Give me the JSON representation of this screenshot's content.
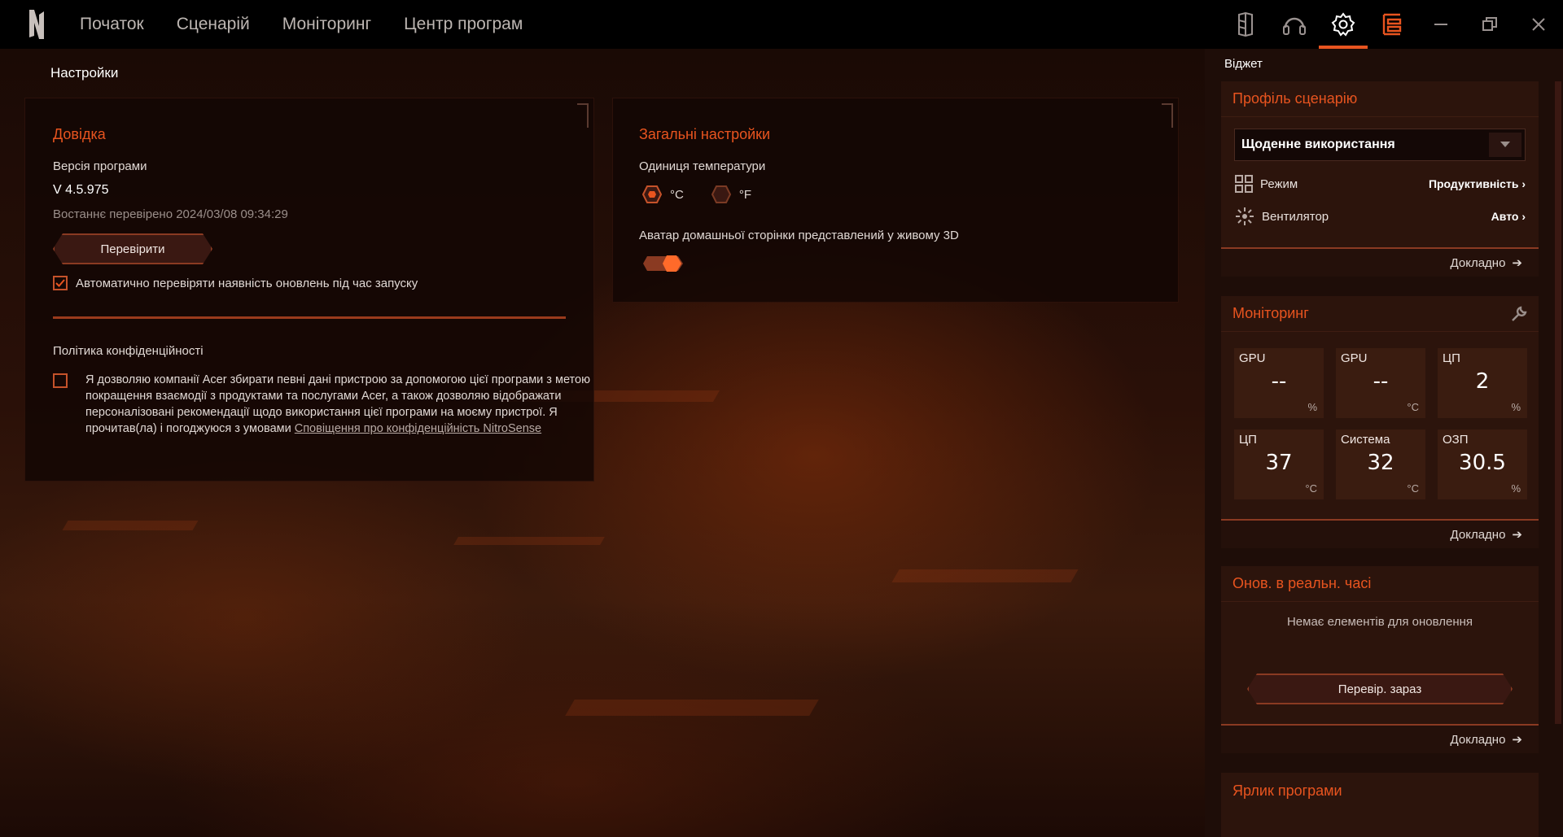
{
  "nav": {
    "items": [
      "Початок",
      "Сценарій",
      "Моніторинг",
      "Центр програм"
    ]
  },
  "top_icons": [
    "keyboard-icon",
    "headset-icon",
    "settings-icon",
    "widget-icon",
    "minimize-icon",
    "restore-icon",
    "close-icon"
  ],
  "page": {
    "title": "Настройки"
  },
  "help": {
    "title": "Довідка",
    "version_label": "Версія програми",
    "version_value": "V 4.5.975",
    "last_checked": "Востаннє перевірено 2024/03/08 09:34:29",
    "check_button": "Перевірити",
    "auto_check_label": "Автоматично перевіряти наявність оновлень під час запуску",
    "auto_check": true,
    "privacy_title": "Політика конфіденційності",
    "privacy_text": "Я дозволяю компанії Acer збирати певні дані пристрою за допомогою цієї програми з метою покращення взаємодії з продуктами та послугами Acer, а також дозволяю відображати персоналізовані рекомендації щодо використання цієї програми на моєму пристрої. Я прочитав(ла) і погоджуюся з умовами",
    "privacy_link": "Сповіщення про конфіденційність NitroSense",
    "privacy_checked": false
  },
  "general": {
    "title": "Загальні настройки",
    "temp_unit_label": "Одиниця температури",
    "unit_c": "°C",
    "unit_f": "°F",
    "selected_unit": "°C",
    "avatar_label": "Аватар домашньої сторінки представлений у живому 3D",
    "avatar_enabled": true
  },
  "sidebar": {
    "title": "Віджет",
    "profile": {
      "title": "Профіль сценарію",
      "selected": "Щоденне використання",
      "mode_label": "Режим",
      "mode_value": "Продуктивність",
      "fan_label": "Вентилятор",
      "fan_value": "Авто",
      "more": "Докладно"
    },
    "monitoring": {
      "title": "Моніторинг",
      "tiles": [
        {
          "name": "GPU",
          "value": "--",
          "unit": "%"
        },
        {
          "name": "GPU",
          "value": "--",
          "unit": "°C"
        },
        {
          "name": "ЦП",
          "value": "2",
          "unit": "%"
        },
        {
          "name": "ЦП",
          "value": "37",
          "unit": "°C"
        },
        {
          "name": "Система",
          "value": "32",
          "unit": "°C"
        },
        {
          "name": "ОЗП",
          "value": "30.5",
          "unit": "%"
        }
      ],
      "more": "Докладно"
    },
    "updates": {
      "title": "Онов. в реальн. часі",
      "empty": "Немає елементів для оновлення",
      "check_button": "Перевір. зараз",
      "more": "Докладно"
    },
    "shortcut": {
      "title": "Ярлик програми"
    }
  },
  "colors": {
    "accent": "#e8541f",
    "bg": "#0d0504",
    "card": "#2c140c"
  }
}
